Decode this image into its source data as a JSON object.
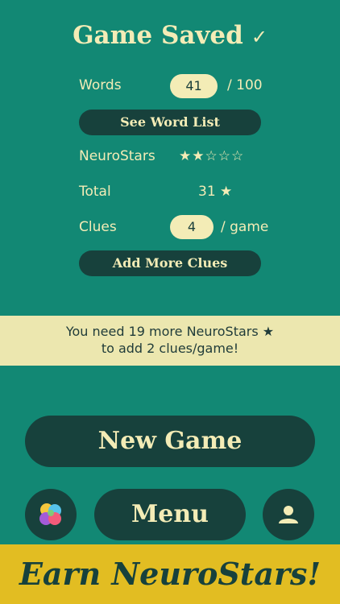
{
  "header": {
    "title": "Game Saved",
    "check": "✓"
  },
  "stats": {
    "words_label": "Words",
    "words_value": "41",
    "words_total": "/ 100",
    "see_word_list": "See Word List",
    "neurostars_label": "NeuroStars",
    "neurostars_rating": "★★☆☆☆",
    "neurostars_rating_value": 2,
    "neurostars_rating_max": 5,
    "total_label": "Total",
    "total_value": "31 ★",
    "clues_label": "Clues",
    "clues_value": "4",
    "clues_unit": "/ game",
    "add_more_clues": "Add More Clues"
  },
  "banner": {
    "line1": "You need 19 more NeuroStars ★",
    "line2": "to add 2 clues/game!"
  },
  "actions": {
    "new_game": "New Game",
    "menu": "Menu"
  },
  "footer": {
    "text": "Earn NeuroStars!"
  },
  "colors": {
    "background": "#128874",
    "cream": "#f3ecb6",
    "dark": "#17413c",
    "banner": "#ece7af",
    "footer": "#e2bd22"
  },
  "icons": {
    "game_center": "game-center-icon",
    "profile": "person-icon"
  }
}
